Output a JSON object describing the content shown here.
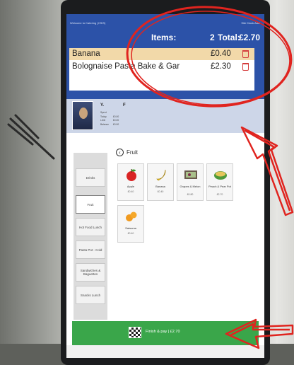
{
  "header": {
    "left_small": "Welcome to Catering (CSIS)",
    "right_small": "Site Kiosk Aadl",
    "items_label": "Items:",
    "items_count": "2",
    "total_label": "Total:",
    "total_value": "£2.70"
  },
  "basket": {
    "items": [
      {
        "name": "Banana",
        "price": "£0.40",
        "selected": true
      },
      {
        "name": "Bolognaise Pasta Bake & Gar",
        "price": "£2.30",
        "selected": false
      }
    ]
  },
  "user": {
    "first_initial": "Y.",
    "last_initial": "F",
    "info": [
      {
        "label": "Spent Today",
        "value": "£0.00"
      },
      {
        "label": "Limit",
        "value": "£0.00"
      },
      {
        "label": "Balance",
        "value": "£0.00"
      }
    ]
  },
  "categories": [
    "Drinks",
    "Fruit",
    "Hot Food Lunch",
    "Pasta Pot - Cold",
    "Sandwiches & Baguettes",
    "Snacks Lunch"
  ],
  "active_category": "Fruit",
  "category_title": "Fruit",
  "products": [
    {
      "name": "Apple",
      "price": "£0.40",
      "icon": "apple-icon"
    },
    {
      "name": "Banana",
      "price": "£0.40",
      "icon": "banana-icon"
    },
    {
      "name": "Grapes & Melon",
      "price": "£0.80",
      "icon": "grapes-melon-icon"
    },
    {
      "name": "Peach & Pear Pot",
      "price": "£2.70",
      "icon": "peach-pear-pot-icon"
    },
    {
      "name": "Satsuma",
      "price": "£0.40",
      "icon": "satsuma-icon"
    }
  ],
  "pay_button": {
    "label": "Finish & pay | £2.70",
    "icon": "chequered-flag-icon"
  },
  "colors": {
    "header": "#2c52a8",
    "selected_row": "#f2d9a9",
    "pay": "#3aa64a",
    "annotation": "#e0241f"
  }
}
